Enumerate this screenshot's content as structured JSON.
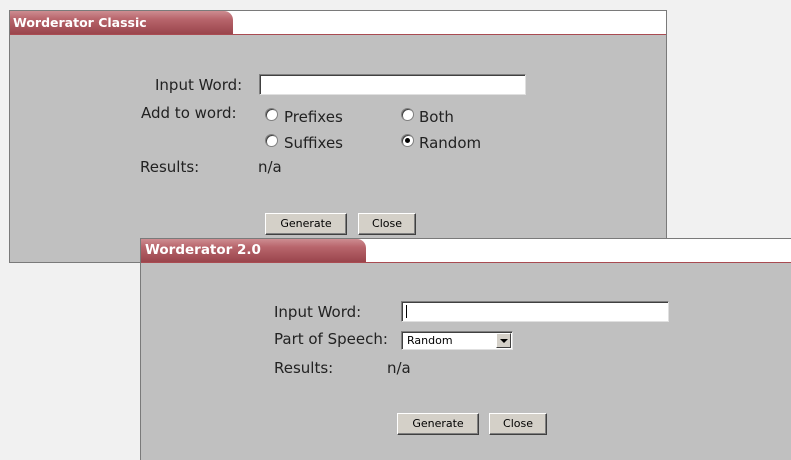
{
  "classic": {
    "title": "Worderator Classic",
    "input_label": "Input Word:",
    "input_value": "",
    "add_label": "Add to word:",
    "options": {
      "prefixes": "Prefixes",
      "both": "Both",
      "suffixes": "Suffixes",
      "random": "Random"
    },
    "selected_option": "random",
    "results_label": "Results:",
    "results_value": "n/a",
    "generate_label": "Generate",
    "close_label": "Close"
  },
  "v2": {
    "title": "Worderator 2.0",
    "input_label": "Input Word:",
    "input_value": "",
    "pos_label": "Part of Speech:",
    "pos_selected": "Random",
    "results_label": "Results:",
    "results_value": "n/a",
    "generate_label": "Generate",
    "close_label": "Close"
  }
}
